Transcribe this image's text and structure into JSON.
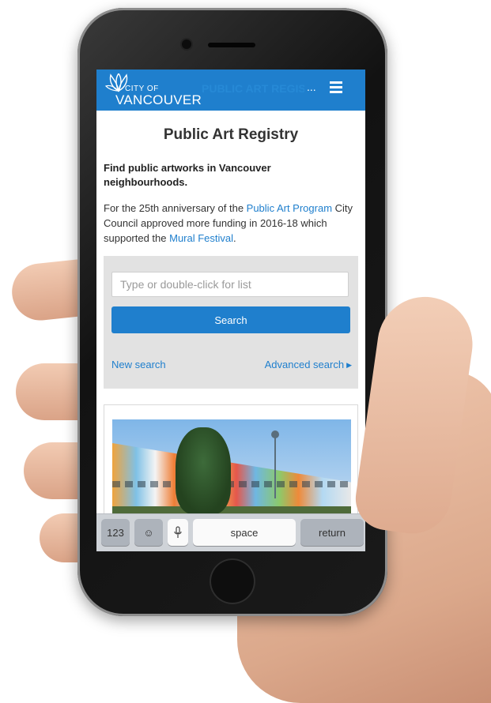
{
  "header": {
    "logo_city_of": "CITY OF",
    "logo_vancouver": "VANCOUVER",
    "title": "PUBLIC ART REGIS",
    "ellipsis": "...",
    "menu_icon": "hamburger-menu-icon"
  },
  "page": {
    "title": "Public Art Registry",
    "intro_bold": "Find public artworks in Vancouver neighbourhoods.",
    "intro_part1": "For the 25th anniversary of the ",
    "intro_link1": "Public Art Program",
    "intro_part2": " City Council approved more funding in 2016-18 which supported the ",
    "intro_link2": "Mural Festival",
    "intro_part3": "."
  },
  "search": {
    "placeholder": "Type or double-click for list",
    "button_label": "Search",
    "new_search": "New search",
    "advanced_search": "Advanced search",
    "advanced_icon": "caret-right-icon"
  },
  "keyboard": {
    "key_123": "123",
    "key_emoji": "☺",
    "key_mic_icon": "microphone-icon",
    "key_space": "space",
    "key_return": "return"
  },
  "colors": {
    "brand_blue": "#1f7fcd",
    "panel_gray": "#e2e2e2"
  }
}
